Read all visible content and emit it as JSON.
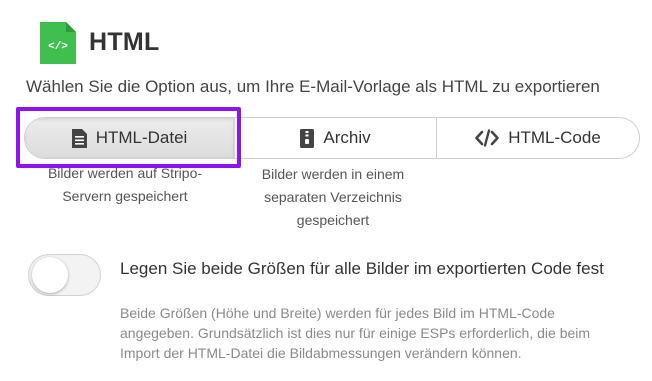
{
  "header": {
    "title": "HTML",
    "icon": "html-file-icon",
    "icon_color": "#3fbf4f"
  },
  "description": "Wählen Sie die Option aus, um Ihre E-Mail-Vorlage als HTML zu exportieren",
  "export_options": [
    {
      "label": "HTML-Datei",
      "icon": "document-icon",
      "selected": true,
      "note_lines": [
        "Bilder werden auf Stripo-",
        "Servern gespeichert"
      ]
    },
    {
      "label": "Archiv",
      "icon": "archive-icon",
      "selected": false,
      "note_lines": [
        "Bilder werden in einem",
        "separaten Verzeichnis",
        "gespeichert"
      ]
    },
    {
      "label": "HTML-Code",
      "icon": "code-icon",
      "selected": false
    }
  ],
  "highlight_color": "#8d14f0",
  "image_size_toggle": {
    "enabled": false,
    "label": "Legen Sie beide Größen für alle Bilder im exportierten Code fest",
    "help": "Beide Größen (Höhe und Breite) werden für jedes Bild im HTML-Code angegeben. Grundsätzlich ist dies nur für einige ESPs erforderlich, die beim Import der HTML-Datei die Bildabmessungen verändern können."
  }
}
